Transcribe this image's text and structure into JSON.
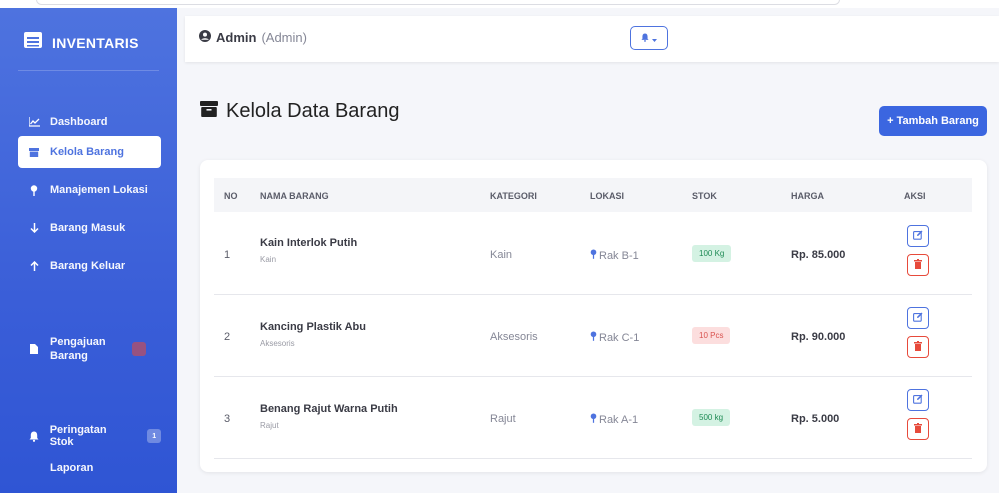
{
  "brand": {
    "title": "INVENTARIS"
  },
  "sidebar": {
    "items": [
      {
        "label": "Dashboard",
        "icon": "chart-line-icon"
      },
      {
        "label": "Kelola Barang",
        "icon": "box-icon",
        "active": true
      },
      {
        "label": "Manajemen Lokasi",
        "icon": "map-pin-icon"
      },
      {
        "label": "Barang Masuk",
        "icon": "arrow-down-icon"
      },
      {
        "label": "Barang Keluar",
        "icon": "arrow-up-icon"
      },
      {
        "label": "Pengajuan Barang",
        "icon": "file-icon"
      },
      {
        "label": "Peringatan Stok",
        "icon": "bell-icon",
        "badge": "1"
      },
      {
        "label": "Laporan"
      }
    ]
  },
  "topbar": {
    "user_name": "Admin",
    "user_role": "(Admin)"
  },
  "page": {
    "title": "Kelola Data Barang",
    "add_button": "+ Tambah Barang"
  },
  "table": {
    "headers": [
      "NO",
      "NAMA BARANG",
      "KATEGORI",
      "LOKASI",
      "STOK",
      "HARGA",
      "AKSI"
    ],
    "rows": [
      {
        "no": "1",
        "name": "Kain Interlok Putih",
        "sub": "Kain",
        "category": "Kain",
        "location": "Rak B-1",
        "stock": "100 Kg",
        "stock_status": "ok",
        "price": "Rp. 85.000"
      },
      {
        "no": "2",
        "name": "Kancing Plastik Abu",
        "sub": "Aksesoris",
        "category": "Aksesoris",
        "location": "Rak C-1",
        "stock": "10 Pcs",
        "stock_status": "low",
        "price": "Rp. 90.000"
      },
      {
        "no": "3",
        "name": "Benang Rajut Warna Putih",
        "sub": "Rajut",
        "category": "Rajut",
        "location": "Rak A-1",
        "stock": "500 kg",
        "stock_status": "ok",
        "price": "Rp. 5.000"
      }
    ]
  },
  "colors": {
    "primary": "#4e73df",
    "danger": "#e74a3b",
    "success": "#1f8b55"
  }
}
